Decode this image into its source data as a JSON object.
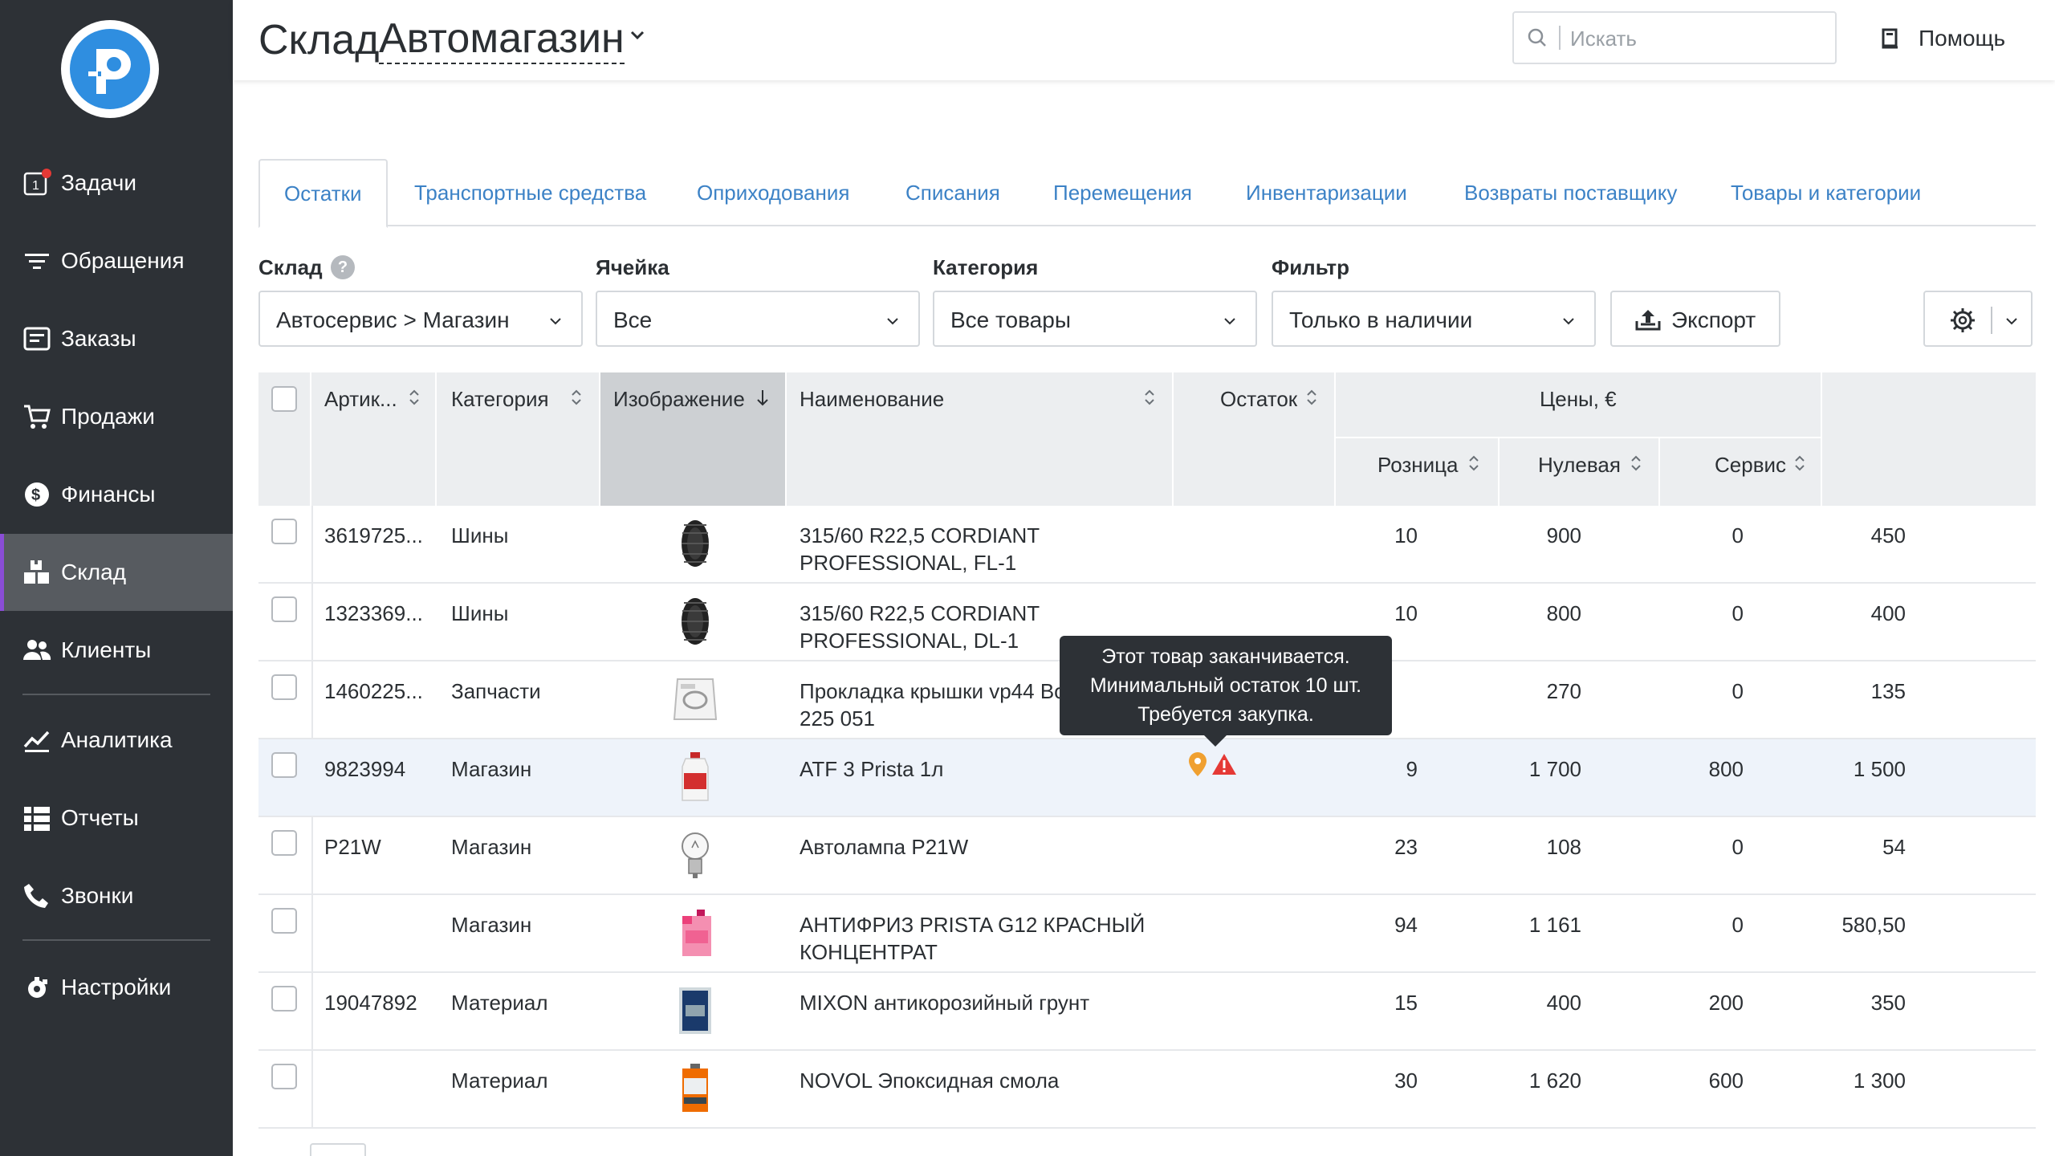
{
  "sidebar": {
    "items": [
      {
        "label": "Задачи",
        "icon": "tasks-icon",
        "badge_color": "#e53935"
      },
      {
        "label": "Обращения",
        "icon": "filter-lines-icon"
      },
      {
        "label": "Заказы",
        "icon": "orders-icon"
      },
      {
        "label": "Продажи",
        "icon": "cart-icon"
      },
      {
        "label": "Финансы",
        "icon": "dollar-coin-icon"
      },
      {
        "label": "Склад",
        "icon": "warehouse-boxes-icon",
        "active": true
      },
      {
        "label": "Клиенты",
        "icon": "users-icon"
      },
      {
        "label": "Аналитика",
        "icon": "chart-line-icon"
      },
      {
        "label": "Отчеты",
        "icon": "reports-list-icon"
      },
      {
        "label": "Звонки",
        "icon": "phone-icon"
      },
      {
        "label": "Настройки",
        "icon": "gear-icon"
      }
    ]
  },
  "header": {
    "title": "Склад",
    "store": "Автомагазин",
    "search_placeholder": "Искать",
    "help": "Помощь"
  },
  "tabs": [
    {
      "label": "Остатки",
      "active": true
    },
    {
      "label": "Транспортные средства"
    },
    {
      "label": "Оприходования"
    },
    {
      "label": "Списания"
    },
    {
      "label": "Перемещения"
    },
    {
      "label": "Инвентаризации"
    },
    {
      "label": "Возвраты поставщику"
    },
    {
      "label": "Товары и категории"
    }
  ],
  "filters": {
    "warehouse": {
      "label": "Склад",
      "value": "Автосервис > Магазин"
    },
    "cell": {
      "label": "Ячейка",
      "value": "Все"
    },
    "category": {
      "label": "Категория",
      "value": "Все товары"
    },
    "filter": {
      "label": "Фильтр",
      "value": "Только в наличии"
    },
    "export": "Экспорт"
  },
  "table": {
    "columns": {
      "article": "Артик...",
      "category": "Категория",
      "image": "Изображение",
      "name": "Наименование",
      "stock": "Остаток",
      "prices": "Цены, €",
      "retail": "Розница",
      "zero": "Нулевая",
      "service": "Сервис"
    },
    "rows": [
      {
        "article": "3619725...",
        "category": "Шины",
        "image": "tire",
        "name1": "315/60 R22,5 CORDIANT",
        "name2": "PROFESSIONAL, FL-1",
        "stock": "10",
        "retail": "900",
        "zero": "0",
        "service": "450"
      },
      {
        "article": "1323369...",
        "category": "Шины",
        "image": "tire",
        "name1": "315/60 R22,5 CORDIANT",
        "name2": "PROFESSIONAL, DL-1",
        "stock": "10",
        "retail": "800",
        "zero": "0",
        "service": "400"
      },
      {
        "article": "1460225...",
        "category": "Запчасти",
        "image": "gasket-bag",
        "name1": "Прокладка крышки vp44 Bo",
        "name2": "225 051",
        "stock": "",
        "retail": "270",
        "zero": "0",
        "service": "135"
      },
      {
        "article": "9823994",
        "category": "Магазин",
        "image": "oil-bottle",
        "name1": "ATF 3 Prista 1л",
        "name2": "",
        "stock": "9",
        "retail": "1 700",
        "zero": "800",
        "service": "1 500",
        "highlight": true
      },
      {
        "article": "P21W",
        "category": "Магазин",
        "image": "bulb",
        "name1": "Автолампа P21W",
        "name2": "",
        "stock": "23",
        "retail": "108",
        "zero": "0",
        "service": "54"
      },
      {
        "article": "",
        "category": "Магазин",
        "image": "antifreeze",
        "name1": "АНТИФРИЗ PRISTA G12 КРАСНЫЙ",
        "name2": "КОНЦЕНТРАТ",
        "stock": "94",
        "retail": "1 161",
        "zero": "0",
        "service": "580,50"
      },
      {
        "article": "19047892",
        "category": "Материал",
        "image": "primer-can",
        "name1": "MIXON антикорозийный грунт",
        "name2": "",
        "stock": "15",
        "retail": "400",
        "zero": "200",
        "service": "350"
      },
      {
        "article": "",
        "category": "Материал",
        "image": "resin-can",
        "name1": "NOVOL Эпоксидная смола",
        "name2": "",
        "stock": "30",
        "retail": "1 620",
        "zero": "600",
        "service": "1 300"
      }
    ]
  },
  "tooltip": {
    "line1": "Этот товар заканчивается.",
    "line2": "Минимальный остаток 10 шт.",
    "line3": "Требуется закупка."
  },
  "colors": {
    "sidebar_bg": "#2d3136",
    "active_nav": "#575b60",
    "accent": "#8a4dd6",
    "link": "#3c82c6",
    "logo": "#2f8ee0",
    "warning": "#e53935",
    "pin": "#f0a030"
  }
}
